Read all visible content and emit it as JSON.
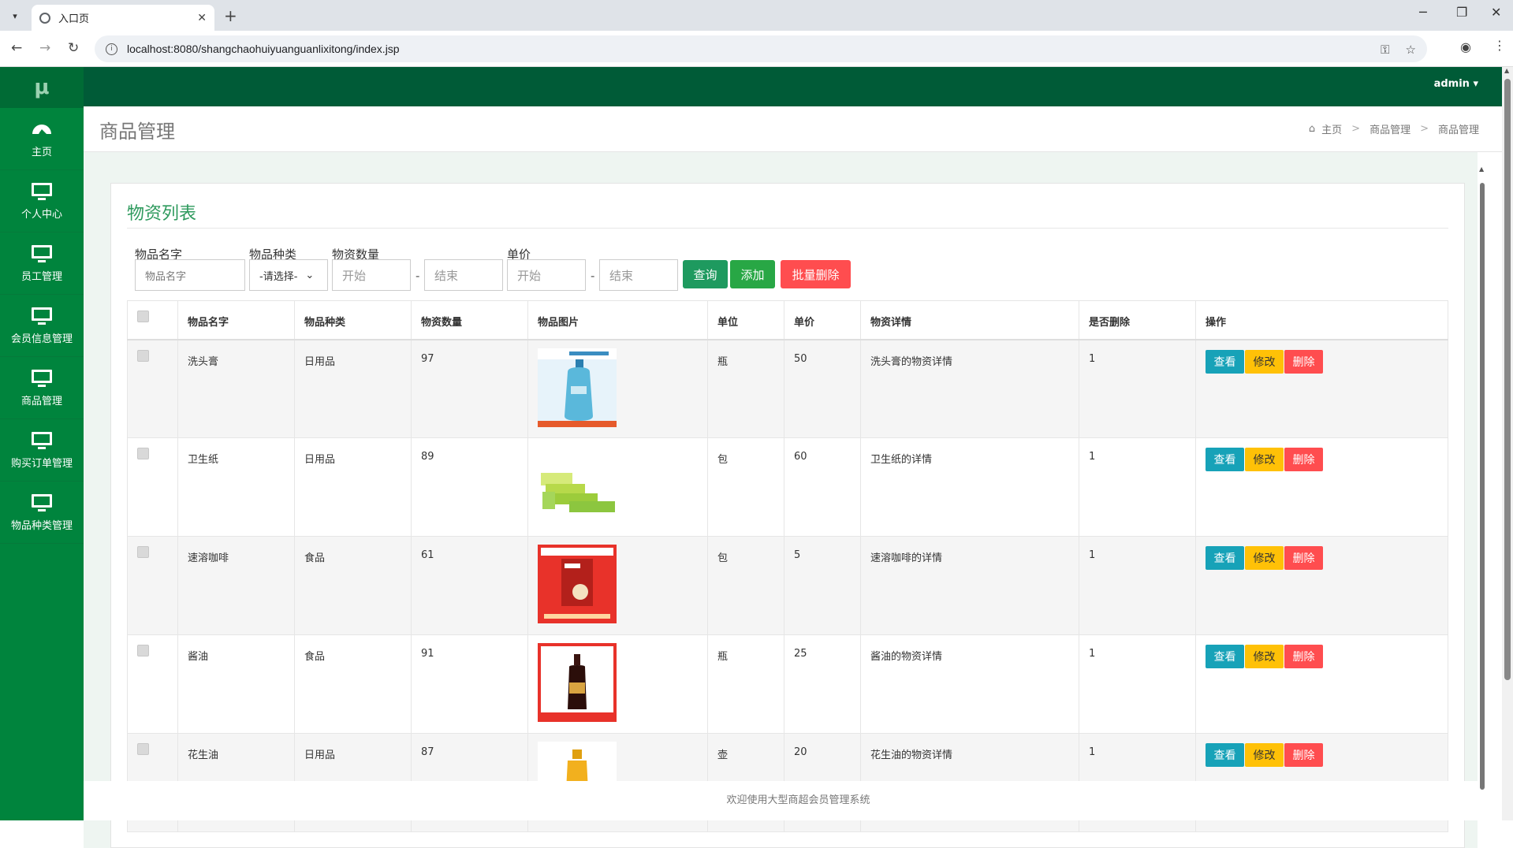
{
  "browser": {
    "tab_title": "入口页",
    "url": "localhost:8080/shangchaohuiyuanguanlixitong/index.jsp"
  },
  "app": {
    "logo": "μ",
    "user": "admin"
  },
  "sidebar": {
    "items": [
      {
        "label": "主页",
        "icon": "dashboard-icon"
      },
      {
        "label": "个人中心",
        "icon": "monitor-icon"
      },
      {
        "label": "员工管理",
        "icon": "monitor-icon"
      },
      {
        "label": "会员信息管理",
        "icon": "monitor-icon"
      },
      {
        "label": "商品管理",
        "icon": "monitor-icon"
      },
      {
        "label": "购买订单管理",
        "icon": "monitor-icon"
      },
      {
        "label": "物品种类管理",
        "icon": "monitor-icon"
      }
    ]
  },
  "header": {
    "title": "商品管理",
    "breadcrumb": [
      "主页",
      "商品管理",
      "商品管理"
    ]
  },
  "panel": {
    "title": "物资列表"
  },
  "search": {
    "name_label": "物品名字",
    "name_placeholder": "物品名字",
    "type_label": "物品种类",
    "type_selected": "-请选择-",
    "qty_label": "物资数量",
    "qty_start": "开始",
    "qty_end": "结束",
    "price_label": "单价",
    "price_start": "开始",
    "price_end": "结束",
    "dash": "-",
    "query_btn": "查询",
    "add_btn": "添加",
    "batch_delete_btn": "批量删除"
  },
  "table": {
    "columns": [
      "物品名字",
      "物品种类",
      "物资数量",
      "物品图片",
      "单位",
      "单价",
      "物资详情",
      "是否删除",
      "操作"
    ],
    "rows": [
      {
        "name": "洗头膏",
        "type": "日用品",
        "qty": "97",
        "image": "shampoo-bottle",
        "unit": "瓶",
        "price": "50",
        "detail": "洗头膏的物资详情",
        "deleted": "1"
      },
      {
        "name": "卫生纸",
        "type": "日用品",
        "qty": "89",
        "image": "tissue-packs",
        "unit": "包",
        "price": "60",
        "detail": "卫生纸的详情",
        "deleted": "1"
      },
      {
        "name": "速溶咖啡",
        "type": "食品",
        "qty": "61",
        "image": "coffee-box",
        "unit": "包",
        "price": "5",
        "detail": "速溶咖啡的详情",
        "deleted": "1"
      },
      {
        "name": "酱油",
        "type": "食品",
        "qty": "91",
        "image": "soy-sauce-bottle",
        "unit": "瓶",
        "price": "25",
        "detail": "酱油的物资详情",
        "deleted": "1"
      },
      {
        "name": "花生油",
        "type": "日用品",
        "qty": "87",
        "image": "oil-bottle",
        "unit": "壶",
        "price": "20",
        "detail": "花生油的物资详情",
        "deleted": "1"
      }
    ],
    "actions": {
      "view": "查看",
      "edit": "修改",
      "delete": "删除"
    }
  },
  "footer": {
    "text": "欢迎使用大型商超会员管理系统"
  },
  "colors": {
    "sidebar": "#00843d",
    "topbar": "#005b37",
    "query": "#1e9a5f",
    "add": "#28a745",
    "batch_delete": "#ff4d4f",
    "view": "#17a2b8",
    "edit": "#ffc107",
    "delete": "#ff4d4f"
  }
}
